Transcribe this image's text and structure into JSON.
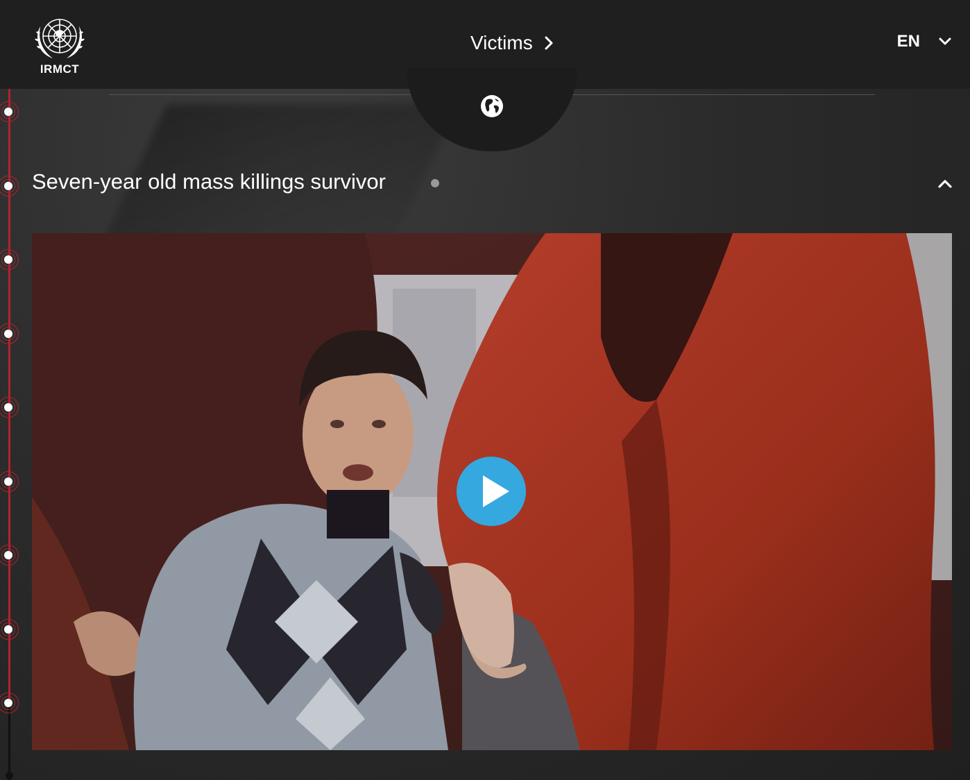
{
  "header": {
    "logo_text": "IRMCT",
    "nav_title": "Victims",
    "language": "EN"
  },
  "section": {
    "title": "Seven-year old mass killings survivor"
  },
  "icons": {
    "logo": "un-emblem-icon",
    "nav_arrow": "chevron-right-icon",
    "language_arrow": "chevron-down-icon",
    "globe": "globe-icon",
    "collapse": "chevron-up-icon",
    "play": "play-icon"
  },
  "colors": {
    "header_bg": "#1f1f1f",
    "timeline_accent": "#b1232d",
    "play_button": "#35a8e0"
  },
  "timeline": {
    "marker_count": 9,
    "active_markers": 9
  }
}
